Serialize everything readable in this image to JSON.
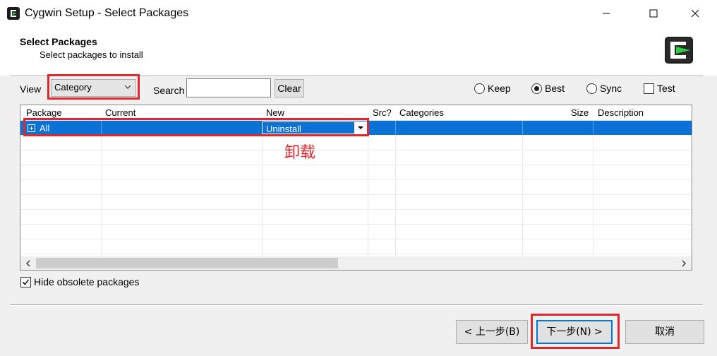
{
  "window": {
    "title": "Cygwin Setup - Select Packages",
    "app_icon": "cygwin-logo-icon"
  },
  "header": {
    "title": "Select Packages",
    "subtitle": "Select packages to install"
  },
  "toolbar": {
    "view_label": "View",
    "view_value": "Category",
    "search_label": "Search",
    "search_value": "",
    "clear_label": "Clear",
    "radios": [
      {
        "label": "Keep",
        "checked": false
      },
      {
        "label": "Best",
        "checked": true
      },
      {
        "label": "Sync",
        "checked": false
      }
    ],
    "test_label": "Test",
    "test_checked": false
  },
  "grid": {
    "columns": [
      "Package",
      "Current",
      "New",
      "Src?",
      "Categories",
      "Size",
      "Description"
    ],
    "rows": [
      {
        "package": "All",
        "current": "",
        "new": "Uninstall",
        "src": "",
        "categories": "",
        "size": "",
        "description": ""
      }
    ]
  },
  "annotation": {
    "text": "卸载",
    "color": "#e3262c"
  },
  "options": {
    "hide_obsolete_label": "Hide obsolete packages",
    "hide_obsolete_checked": true
  },
  "buttons": {
    "back": "< 上一步(B)",
    "next": "下一步(N) >",
    "cancel": "取消"
  },
  "colors": {
    "selection": "#0a72d6",
    "accent": "#0078d7",
    "annotation": "#e3262c"
  }
}
